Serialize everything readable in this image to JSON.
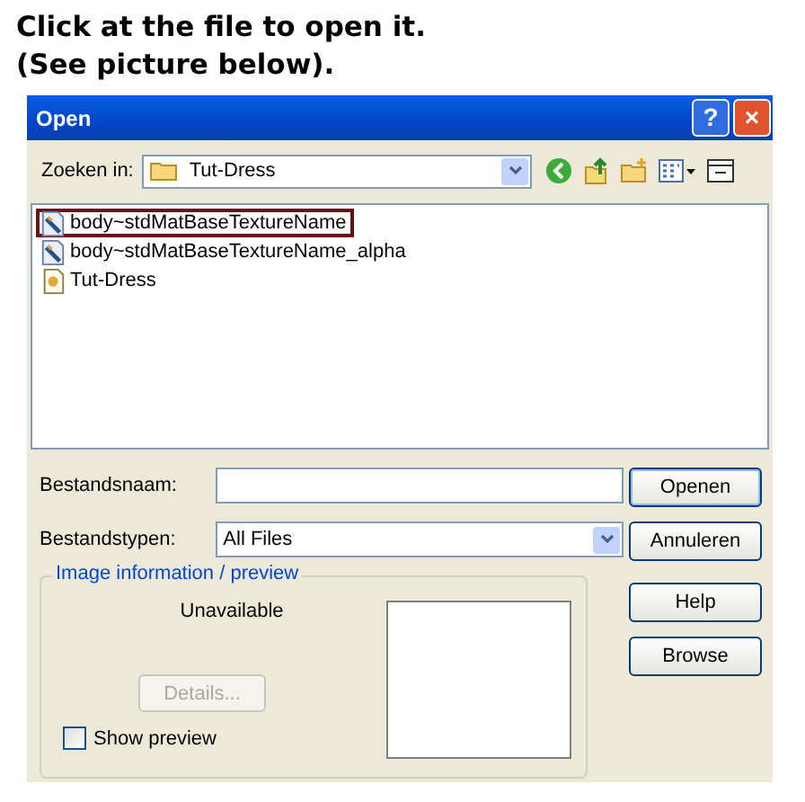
{
  "instructions": [
    "Click at the file to open it.",
    "(See picture below)."
  ],
  "window": {
    "title": "Open",
    "help_button": "?",
    "close_button": "×"
  },
  "look_in": {
    "label": "Zoeken in:",
    "value": "Tut-Dress"
  },
  "files": [
    {
      "name": "body~stdMatBaseTextureName",
      "kind": "image",
      "highlighted": true
    },
    {
      "name": "body~stdMatBaseTextureName_alpha",
      "kind": "image",
      "highlighted": false
    },
    {
      "name": "Tut-Dress",
      "kind": "project",
      "highlighted": false
    }
  ],
  "file_name": {
    "label": "Bestandsnaam:"
  },
  "file_type": {
    "label": "Bestandstypen:",
    "value": "All Files"
  },
  "buttons": [
    {
      "label": "Openen",
      "default": true
    },
    {
      "label": "Annuleren",
      "default": false
    },
    {
      "label": "Help",
      "default": false
    },
    {
      "label": "Browse",
      "default": false
    }
  ],
  "preview_group": {
    "title": "Image information / preview",
    "status": "Unavailable",
    "details_button": {
      "label": "Details...",
      "disabled": true
    },
    "show_preview": {
      "label": "Show preview",
      "checked": false
    }
  }
}
